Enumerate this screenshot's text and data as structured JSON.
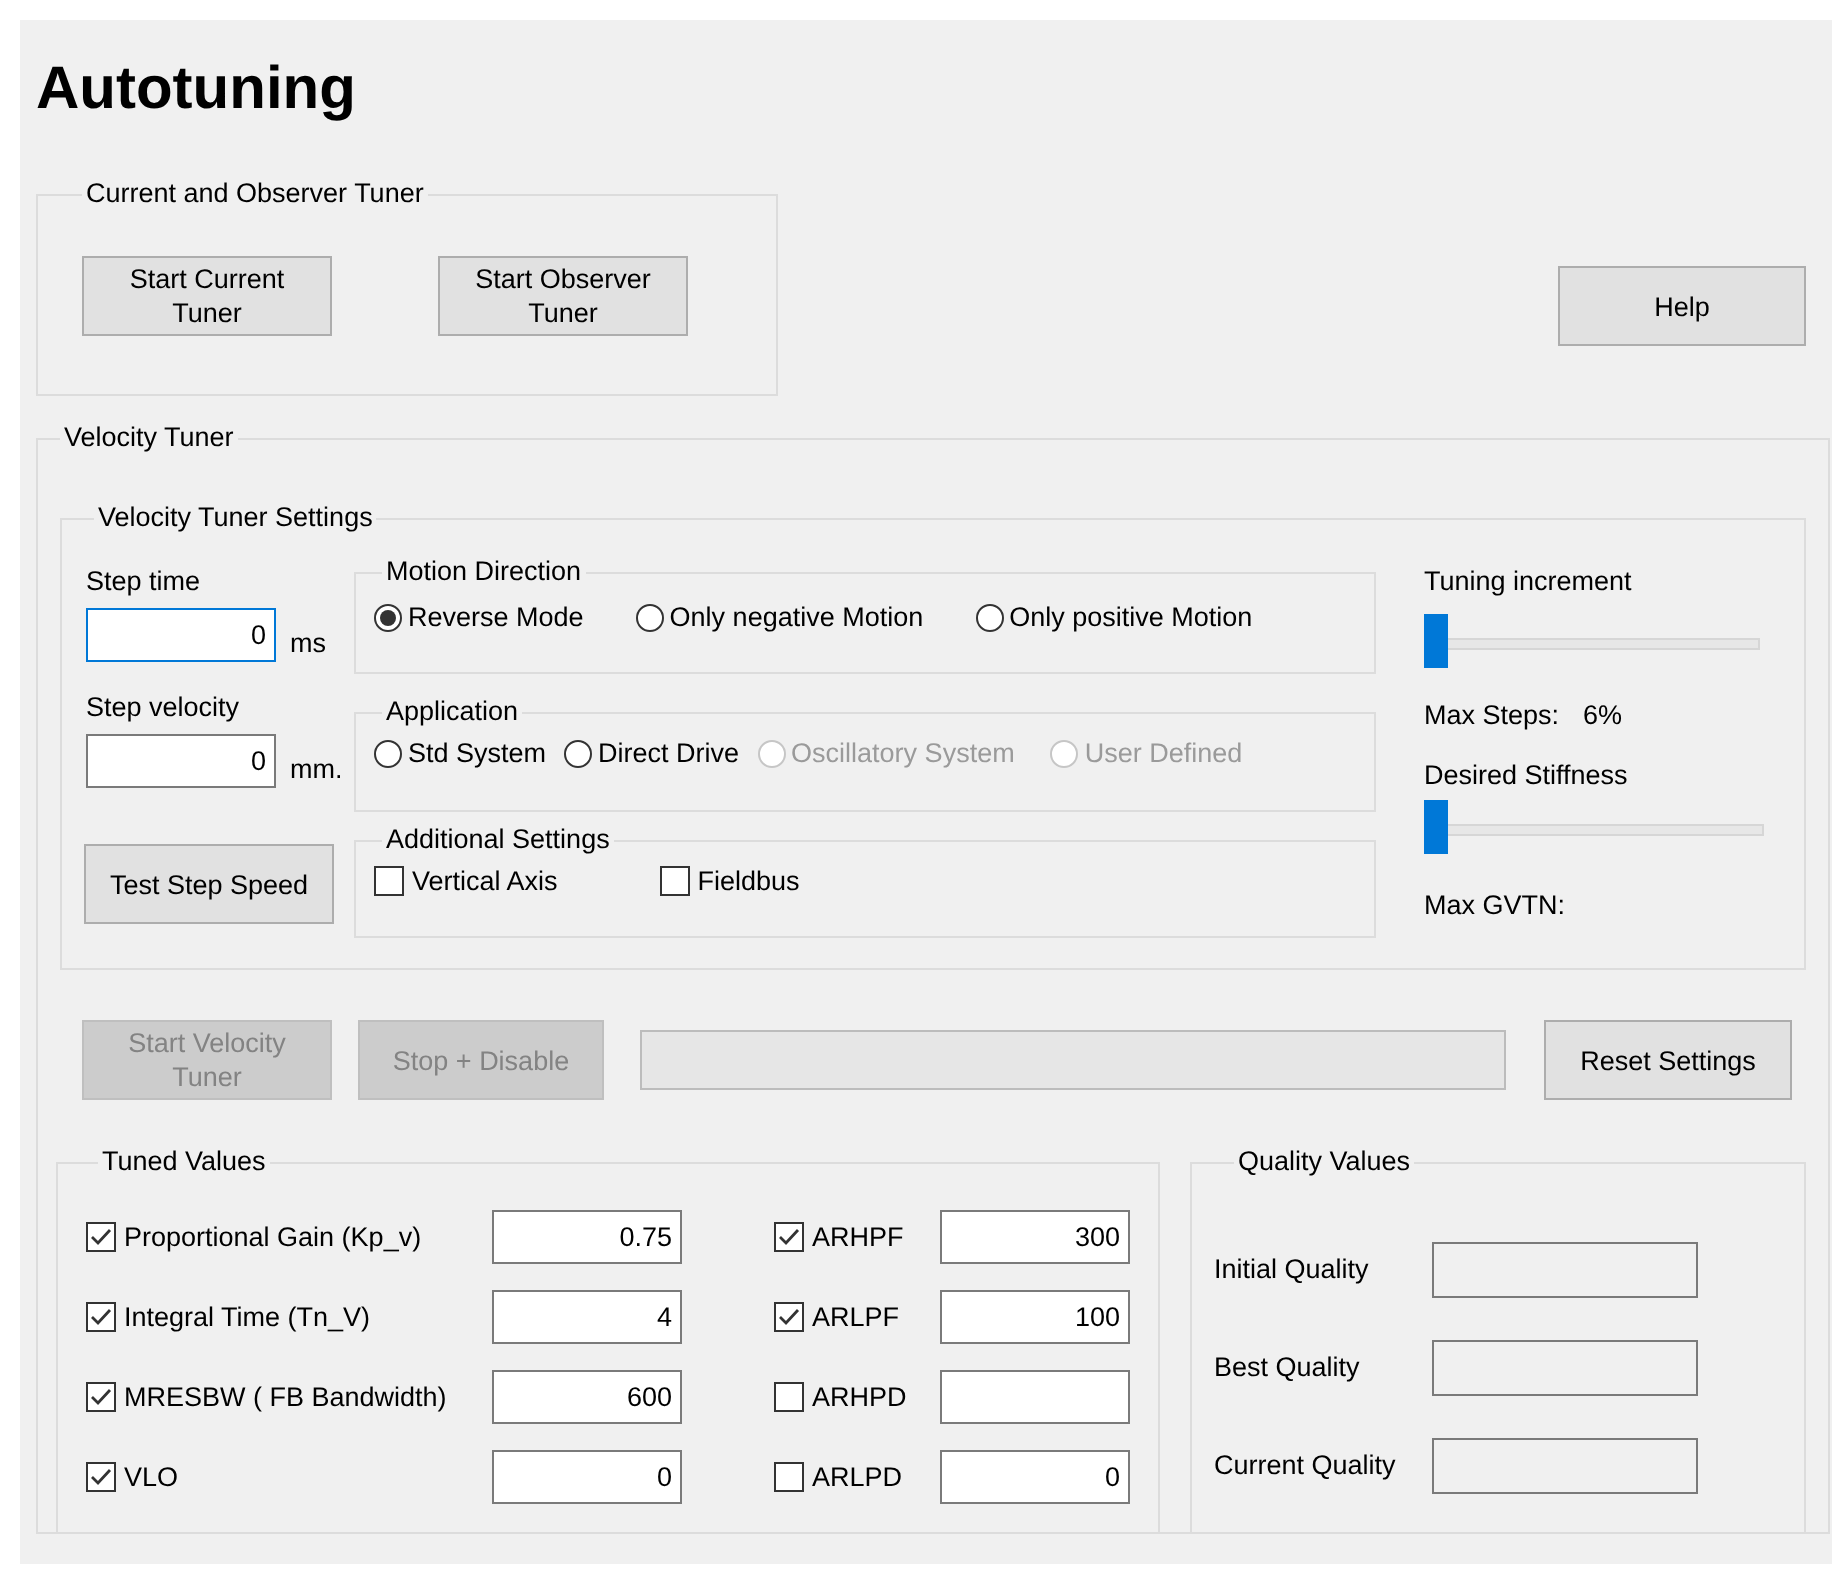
{
  "window": {
    "title": "Autotuning"
  },
  "current_observer_tuner": {
    "title": "Current and Observer Tuner",
    "buttons": [
      {
        "label": "Start Current Tuner",
        "disabled": false
      },
      {
        "label": "Start Observer Tuner",
        "disabled": false
      }
    ]
  },
  "help_button": {
    "label": "Help",
    "disabled": false
  },
  "velocity_tuner": {
    "title": "Velocity Tuner",
    "settings": {
      "title": "Velocity Tuner Settings",
      "step_time": {
        "label": "Step time",
        "value": "0",
        "unit": "ms",
        "focused": true
      },
      "step_velocity": {
        "label": "Step velocity",
        "value": "0",
        "unit": "mm.",
        "focused": false
      },
      "test_button": {
        "label": "Test Step Speed",
        "disabled": false
      },
      "motion_direction": {
        "title": "Motion Direction",
        "options": [
          {
            "label": "Reverse Mode",
            "selected": true,
            "disabled": false
          },
          {
            "label": "Only negative Motion",
            "selected": false,
            "disabled": false
          },
          {
            "label": "Only positive Motion",
            "selected": false,
            "disabled": false
          }
        ]
      },
      "application": {
        "title": "Application",
        "options": [
          {
            "label": "Std System",
            "selected": false,
            "disabled": false
          },
          {
            "label": "Direct Drive",
            "selected": false,
            "disabled": false
          },
          {
            "label": "Oscillatory System",
            "selected": false,
            "disabled": true
          },
          {
            "label": "User Defined",
            "selected": false,
            "disabled": true
          }
        ]
      },
      "additional_settings": {
        "title": "Additional Settings",
        "options": [
          {
            "label": "Vertical Axis",
            "checked": false
          },
          {
            "label": "Fieldbus",
            "checked": false
          }
        ]
      },
      "tuning_increment": {
        "label": "Tuning increment",
        "level": 0
      },
      "max_steps": {
        "label": "Max Steps:",
        "value": "6%"
      },
      "desired_stiffness": {
        "label": "Desired Stiffness",
        "level": 0
      },
      "max_gvtn": {
        "label": "Max GVTN:"
      }
    },
    "actions": [
      {
        "label": "Start Velocity Tuner",
        "disabled": true
      },
      {
        "label": "Stop + Disable",
        "disabled": true
      }
    ],
    "reset_button": {
      "label": "Reset Settings",
      "disabled": false
    },
    "tuned_values": {
      "title": "Tuned Values",
      "items": [
        {
          "label": "Proportional Gain (Kp_v)",
          "checked": true,
          "value": "0.75"
        },
        {
          "label": "Integral Time (Tn_V)",
          "checked": true,
          "value": "4"
        },
        {
          "label": "MRESBW ( FB Bandwidth)",
          "checked": true,
          "value": "600"
        },
        {
          "label": "VLO",
          "checked": true,
          "value": "0"
        },
        {
          "label": "ARHPF",
          "checked": true,
          "value": "300"
        },
        {
          "label": "ARLPF",
          "checked": true,
          "value": "100"
        },
        {
          "label": "ARHPD",
          "checked": false
        },
        {
          "label": "ARLPD",
          "checked": false,
          "value": "0"
        }
      ]
    },
    "quality_values": {
      "title": "Quality Values",
      "items": [
        {
          "label": "Initial Quality"
        },
        {
          "label": "Best Quality"
        },
        {
          "label": "Current Quality"
        }
      ]
    }
  }
}
